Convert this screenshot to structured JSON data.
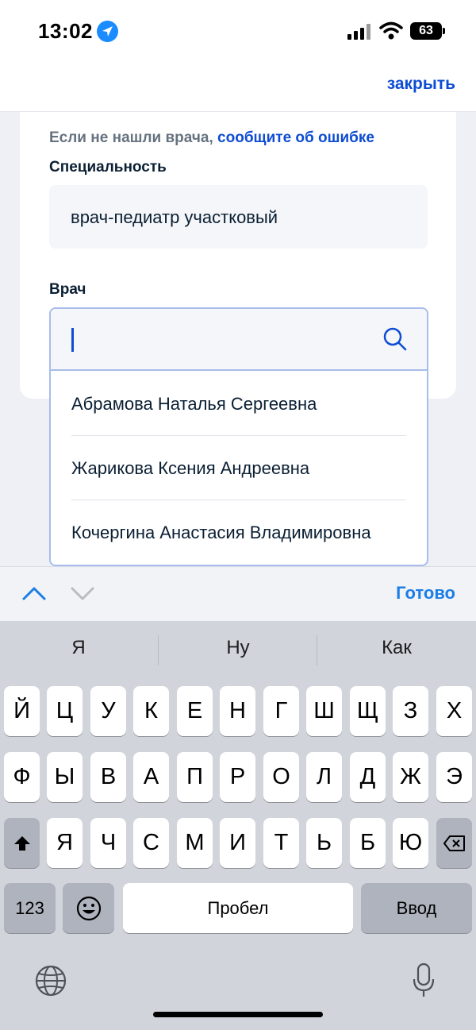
{
  "status_bar": {
    "time": "13:02",
    "battery": "63"
  },
  "nav": {
    "close_label": "закрыть"
  },
  "form": {
    "hint_text": "Если не нашли врача,",
    "hint_link": "сообщите об ошибке",
    "specialty_label": "Специальность",
    "specialty_value": "врач-педиатр участковый",
    "doctor_label": "Врач",
    "doctor_search_value": "",
    "doctor_options": [
      "Абрамова Наталья Сергеевна",
      "Жарикова Ксения Андреевна",
      "Кочергина Анастасия Владимировна"
    ]
  },
  "accessory": {
    "done_label": "Готово"
  },
  "keyboard": {
    "suggestions": [
      "Я",
      "Ну",
      "Как"
    ],
    "row1": [
      "Й",
      "Ц",
      "У",
      "К",
      "Е",
      "Н",
      "Г",
      "Ш",
      "Щ",
      "З",
      "Х"
    ],
    "row2": [
      "Ф",
      "Ы",
      "В",
      "А",
      "П",
      "Р",
      "О",
      "Л",
      "Д",
      "Ж",
      "Э"
    ],
    "row3": [
      "Я",
      "Ч",
      "С",
      "М",
      "И",
      "Т",
      "Ь",
      "Б",
      "Ю"
    ],
    "numbers_label": "123",
    "space_label": "Пробел",
    "return_label": "Ввод"
  },
  "colors": {
    "accent": "#0d4cd3",
    "ios_blue": "#1a7ee6",
    "keyboard_bg": "#d1d4db"
  }
}
